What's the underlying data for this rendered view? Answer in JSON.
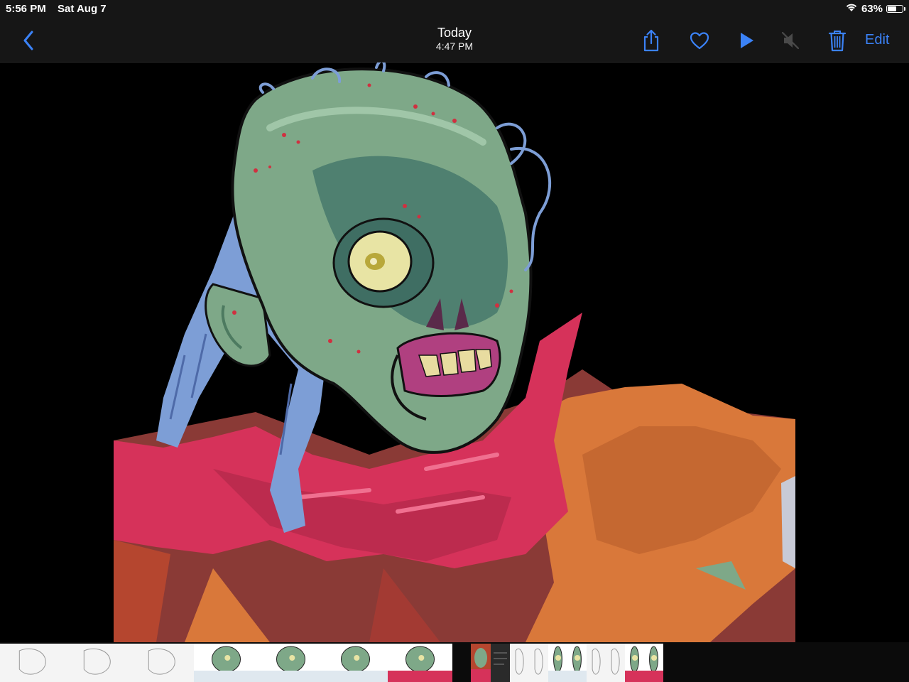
{
  "status": {
    "time": "5:56 PM",
    "date": "Sat Aug 7",
    "battery_text": "63%",
    "battery_level": 0.63,
    "icons": [
      "wifi-icon",
      "battery-icon"
    ]
  },
  "nav": {
    "title": "Today",
    "subtitle": "4:47 PM",
    "edit_label": "Edit",
    "icons": [
      "chevron-left-icon",
      "share-icon",
      "heart-icon",
      "play-icon",
      "speaker-muted-icon",
      "trash-icon"
    ]
  },
  "colors": {
    "accent": "#3b82f6",
    "bar_bg": "#161616",
    "photo_bg": "#000000",
    "skin": "#7ea888",
    "hair": "#7d9ed6",
    "cloth_red": "#d6325a",
    "cloth_orange": "#d9783a",
    "cloth_brown": "#8a3a36"
  },
  "filmstrip": {
    "thumb_kinds": [
      "sketch",
      "sketch",
      "sketch",
      "color",
      "color",
      "color",
      "color-red",
      "selected",
      "dark",
      "sketch",
      "sketch",
      "color",
      "color",
      "sketch",
      "sketch",
      "color-red",
      "color-red"
    ]
  }
}
